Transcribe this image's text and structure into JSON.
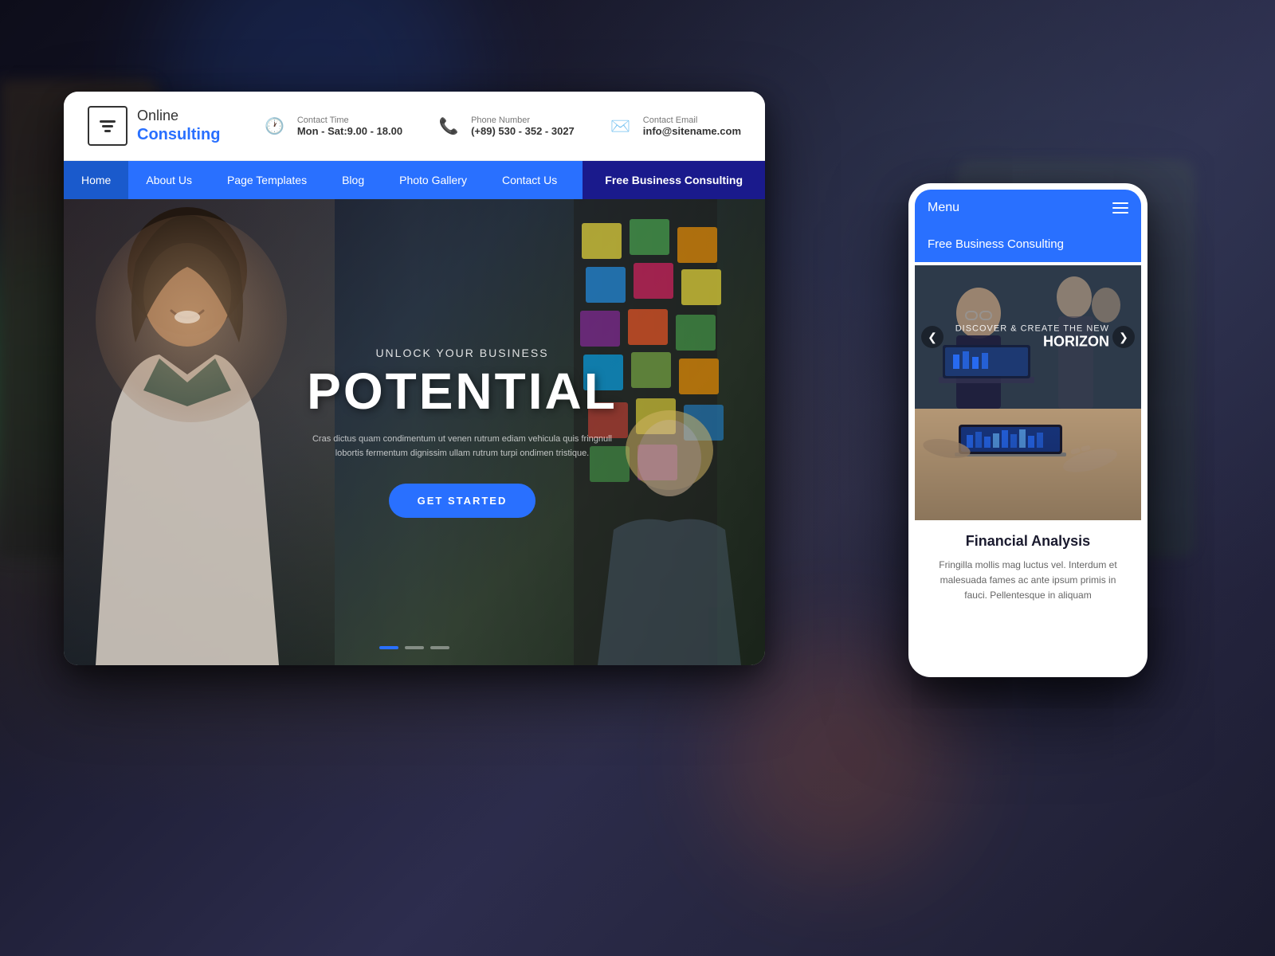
{
  "background": {
    "color": "#1a1a2e"
  },
  "desktop": {
    "logo": {
      "name_part1": "Online",
      "name_part2": "Consulting"
    },
    "header": {
      "contact_time_label": "Contact Time",
      "contact_time_value": "Mon - Sat:9.00 - 18.00",
      "phone_label": "Phone Number",
      "phone_value": "(+89) 530 - 352 - 3027",
      "email_label": "Contact Email",
      "email_value": "info@sitename.com"
    },
    "nav": {
      "items": [
        {
          "label": "Home",
          "active": true
        },
        {
          "label": "About Us",
          "active": false
        },
        {
          "label": "Page Templates",
          "active": false
        },
        {
          "label": "Blog",
          "active": false
        },
        {
          "label": "Photo Gallery",
          "active": false
        },
        {
          "label": "Contact Us",
          "active": false
        }
      ],
      "cta": "Free Business Consulting"
    },
    "hero": {
      "subtitle": "UNLOCK YOUR BUSINESS",
      "title": "POTENTIAL",
      "description": "Cras dictus quam condimentum ut venen rutrum ediam vehicula quis fringnull lobortis fermentum dignissim ullam rutrum turpi ondimen tristique.",
      "button": "GET STARTED",
      "dots": [
        {
          "active": true
        },
        {
          "active": false
        },
        {
          "active": false
        }
      ]
    }
  },
  "mobile": {
    "menu_label": "Menu",
    "cta_label": "Free Business Consulting",
    "slider": {
      "discover_text": "DISCOVER & CREATE THE NEW",
      "horizon_text": "HORIZON",
      "prev_arrow": "❮",
      "next_arrow": "❯"
    },
    "card": {
      "title": "Financial Analysis",
      "description": "Fringilla mollis mag luctus vel. Interdum et malesuada fames ac ante ipsum primis in fauci. Pellentesque in aliquam"
    }
  }
}
